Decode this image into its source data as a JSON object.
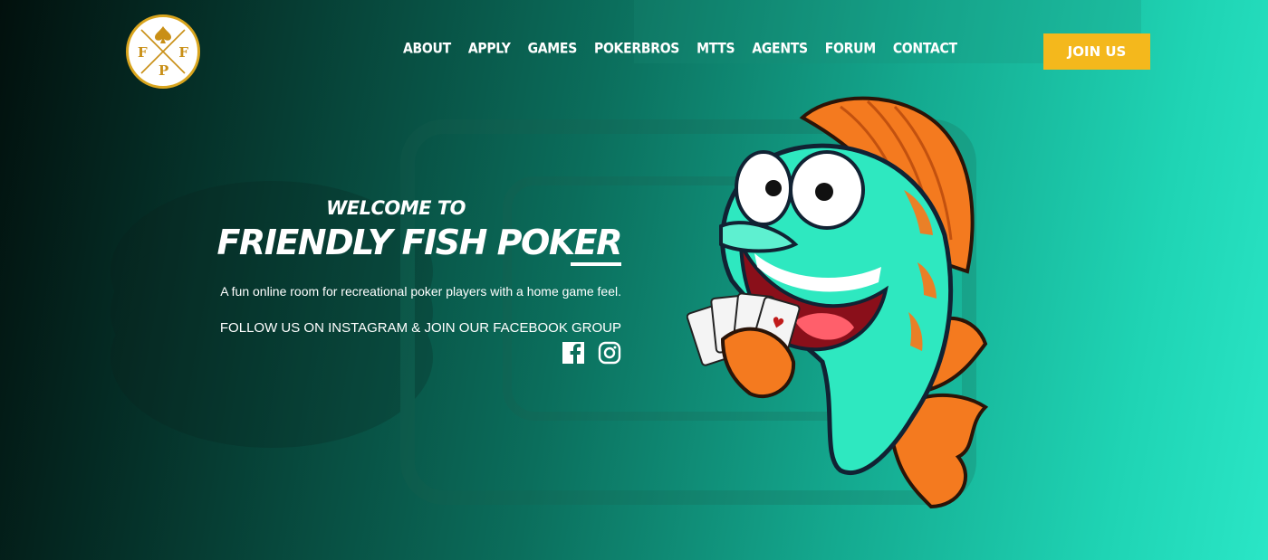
{
  "logo": {
    "letter_left": "F",
    "letter_right": "F",
    "letter_bottom": "P",
    "icon": "spade-icon"
  },
  "nav": {
    "items": [
      {
        "label": "ABOUT"
      },
      {
        "label": "APPLY"
      },
      {
        "label": "GAMES"
      },
      {
        "label": "POKERBROS"
      },
      {
        "label": "MTTS"
      },
      {
        "label": "AGENTS"
      },
      {
        "label": "FORUM"
      },
      {
        "label": "CONTACT"
      }
    ]
  },
  "cta": {
    "join_label": "JOIN US"
  },
  "hero": {
    "welcome": "WELCOME TO",
    "title": "FRIENDLY FISH POKER",
    "tagline": "A fun online room for recreational poker players with a home game feel.",
    "follow": "FOLLOW US ON INSTAGRAM & JOIN OUR FACEBOOK GROUP"
  },
  "social": {
    "icons": [
      "facebook-icon",
      "instagram-icon"
    ]
  },
  "colors": {
    "accent": "#f4b81c",
    "logo_gold": "#d9a51e",
    "fish_teal": "#2ee8c0",
    "fin_orange": "#f47a1f"
  }
}
